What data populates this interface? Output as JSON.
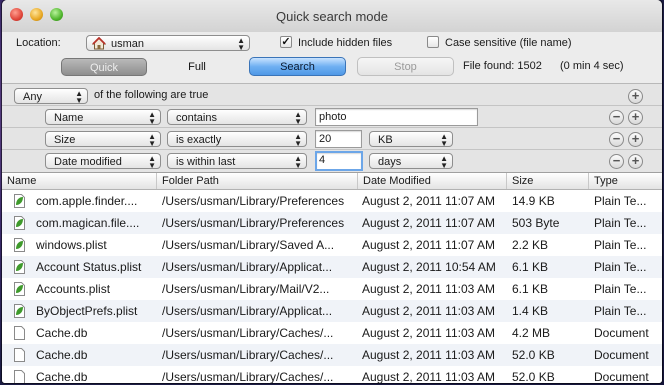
{
  "window": {
    "title": "Quick search mode"
  },
  "toolbar": {
    "location_label": "Location:",
    "location_value": "usman",
    "include_hidden_label": "Include hidden files",
    "include_hidden_checked": "✓",
    "case_sensitive_label": "Case sensitive (file name)",
    "quick_label": "Quick",
    "full_label": "Full",
    "search_label": "Search",
    "stop_label": "Stop",
    "files_found": "File found: 1502",
    "elapsed": "(0 min 4 sec)"
  },
  "rules": {
    "match_value": "Any",
    "match_suffix": "of the following are true",
    "rows": [
      {
        "attribute": "Name",
        "operator": "contains",
        "value": "photo",
        "unit": ""
      },
      {
        "attribute": "Size",
        "operator": "is exactly",
        "value": "20",
        "unit": "KB"
      },
      {
        "attribute": "Date modified",
        "operator": "is within last",
        "value": "4",
        "unit": "days"
      }
    ]
  },
  "table": {
    "columns": [
      "Name",
      "Folder Path",
      "Date Modified",
      "Size",
      "Type"
    ],
    "rows": [
      {
        "icon": "plist-icon",
        "name": "com.apple.finder....",
        "path": "/Users/usman/Library/Preferences",
        "date": "August 2, 2011 11:07 AM",
        "size": "14.9 KB",
        "type": "Plain Te..."
      },
      {
        "icon": "plist-icon",
        "name": "com.magican.file....",
        "path": "/Users/usman/Library/Preferences",
        "date": "August 2, 2011 11:07 AM",
        "size": "503 Byte",
        "type": "Plain Te..."
      },
      {
        "icon": "plist-icon",
        "name": "windows.plist",
        "path": "/Users/usman/Library/Saved A...",
        "date": "August 2, 2011 11:07 AM",
        "size": "2.2 KB",
        "type": "Plain Te..."
      },
      {
        "icon": "plist-icon",
        "name": "Account Status.plist",
        "path": "/Users/usman/Library/Applicat...",
        "date": "August 2, 2011 10:54 AM",
        "size": "6.1 KB",
        "type": "Plain Te..."
      },
      {
        "icon": "plist-icon",
        "name": "Accounts.plist",
        "path": "/Users/usman/Library/Mail/V2...",
        "date": "August 2, 2011 11:03 AM",
        "size": "6.1 KB",
        "type": "Plain Te..."
      },
      {
        "icon": "plist-icon",
        "name": "ByObjectPrefs.plist",
        "path": "/Users/usman/Library/Applicat...",
        "date": "August 2, 2011 11:03 AM",
        "size": "1.4 KB",
        "type": "Plain Te..."
      },
      {
        "icon": "document-icon",
        "name": "Cache.db",
        "path": "/Users/usman/Library/Caches/...",
        "date": "August 2, 2011 11:03 AM",
        "size": "4.2 MB",
        "type": "Document"
      },
      {
        "icon": "document-icon",
        "name": "Cache.db",
        "path": "/Users/usman/Library/Caches/...",
        "date": "August 2, 2011 11:03 AM",
        "size": "52.0 KB",
        "type": "Document"
      },
      {
        "icon": "document-icon",
        "name": "Cache.db",
        "path": "/Users/usman/Library/Caches/...",
        "date": "August 2, 2011 11:03 AM",
        "size": "52.0 KB",
        "type": "Document"
      }
    ]
  }
}
